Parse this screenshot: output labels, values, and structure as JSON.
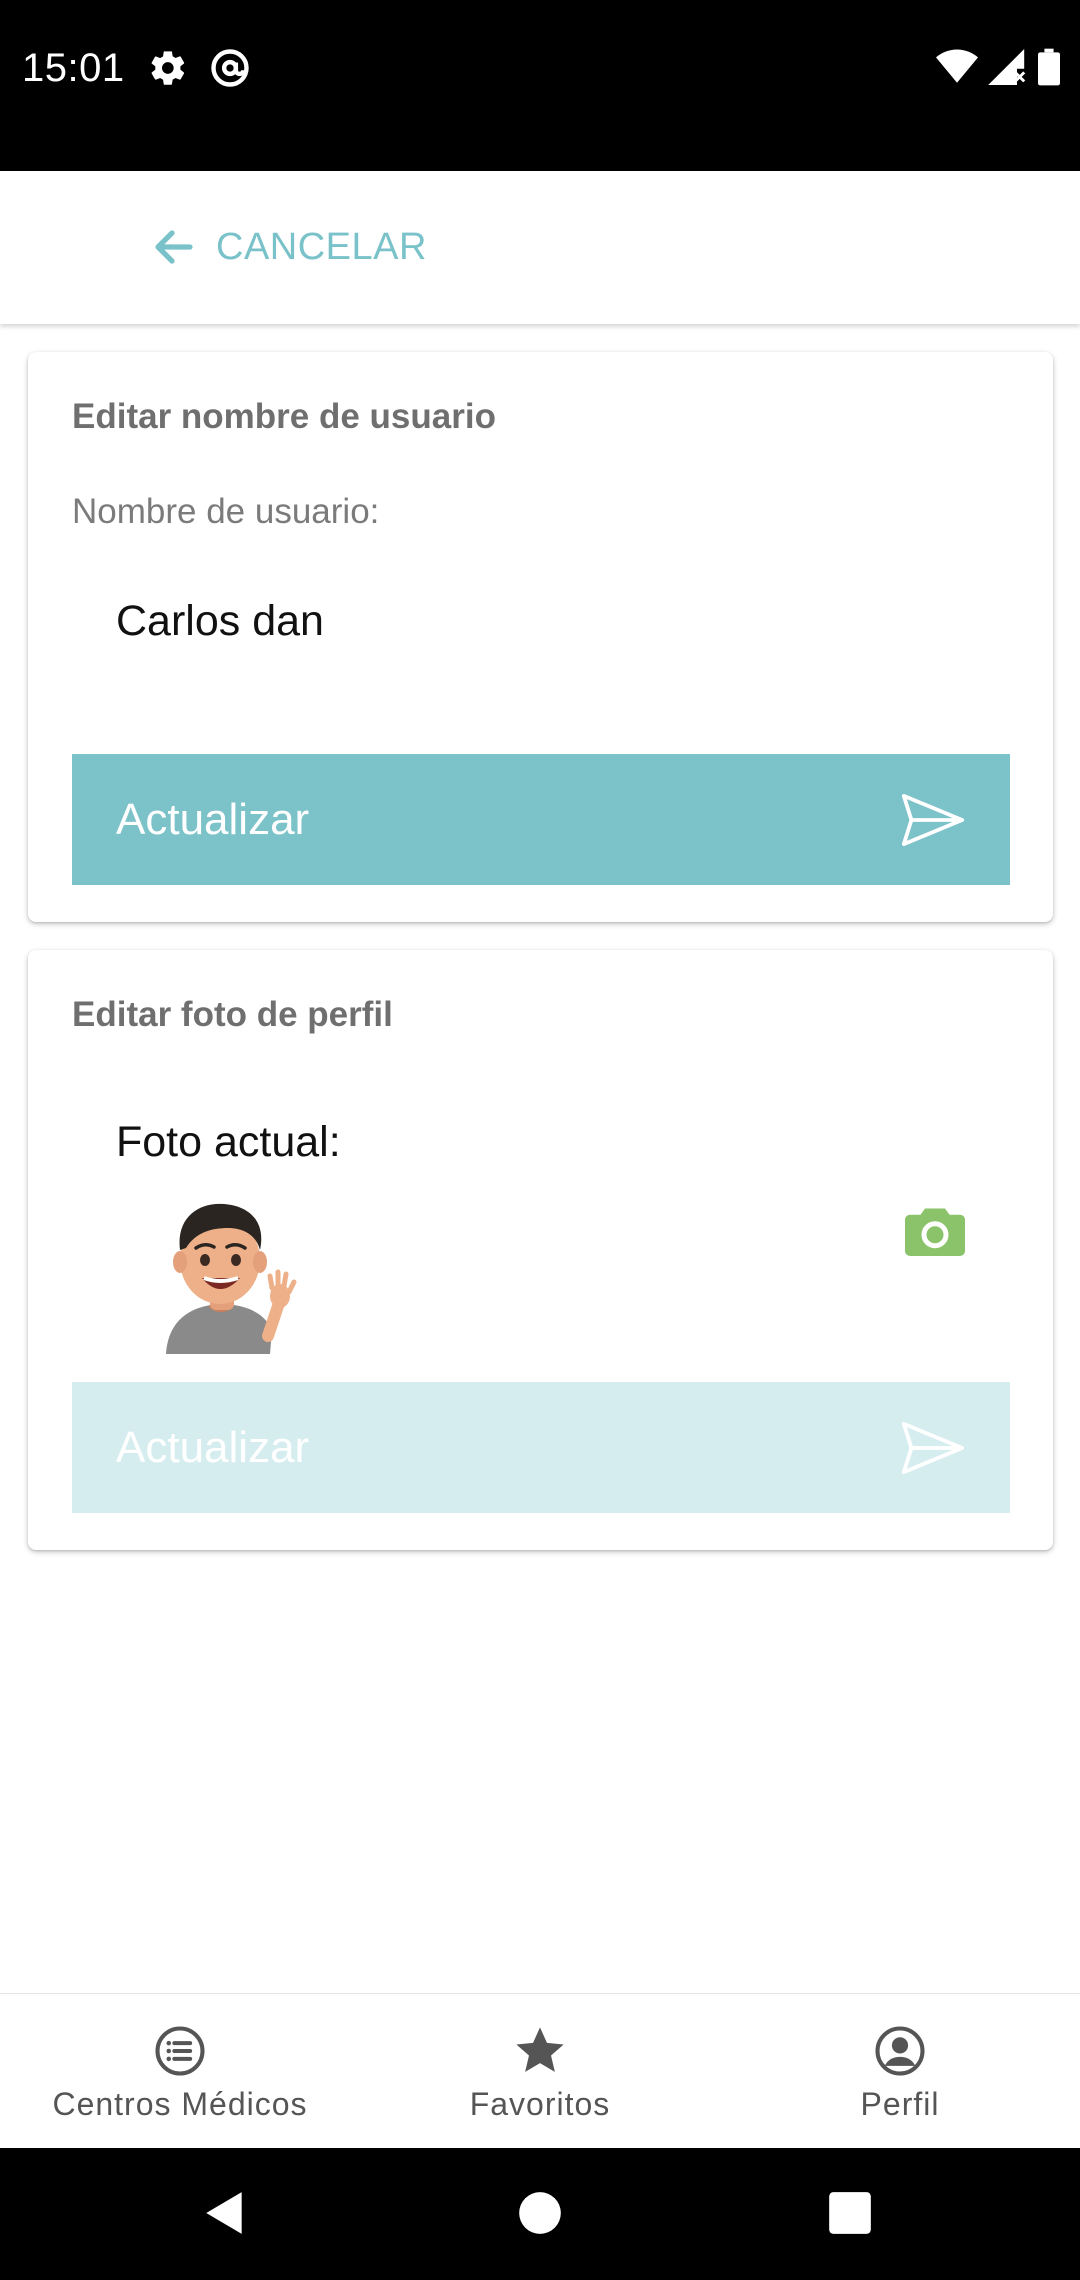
{
  "status_bar": {
    "time": "15:01"
  },
  "header": {
    "cancel_label": "CANCELAR"
  },
  "username_card": {
    "title": "Editar nombre de usuario",
    "field_label": "Nombre de usuario:",
    "field_value": "Carlos dan",
    "button_label": "Actualizar"
  },
  "photo_card": {
    "title": "Editar foto de perfil",
    "current_label": "Foto actual:",
    "button_label": "Actualizar"
  },
  "bottom_nav": {
    "items": [
      {
        "label": "Centros Médicos",
        "icon": "list-icon"
      },
      {
        "label": "Favoritos",
        "icon": "star-icon"
      },
      {
        "label": "Perfil",
        "icon": "account-circle-icon"
      }
    ]
  },
  "colors": {
    "accent": "#7cc2c9",
    "accent_disabled": "#d6edef",
    "camera_green": "#8bc36a"
  }
}
